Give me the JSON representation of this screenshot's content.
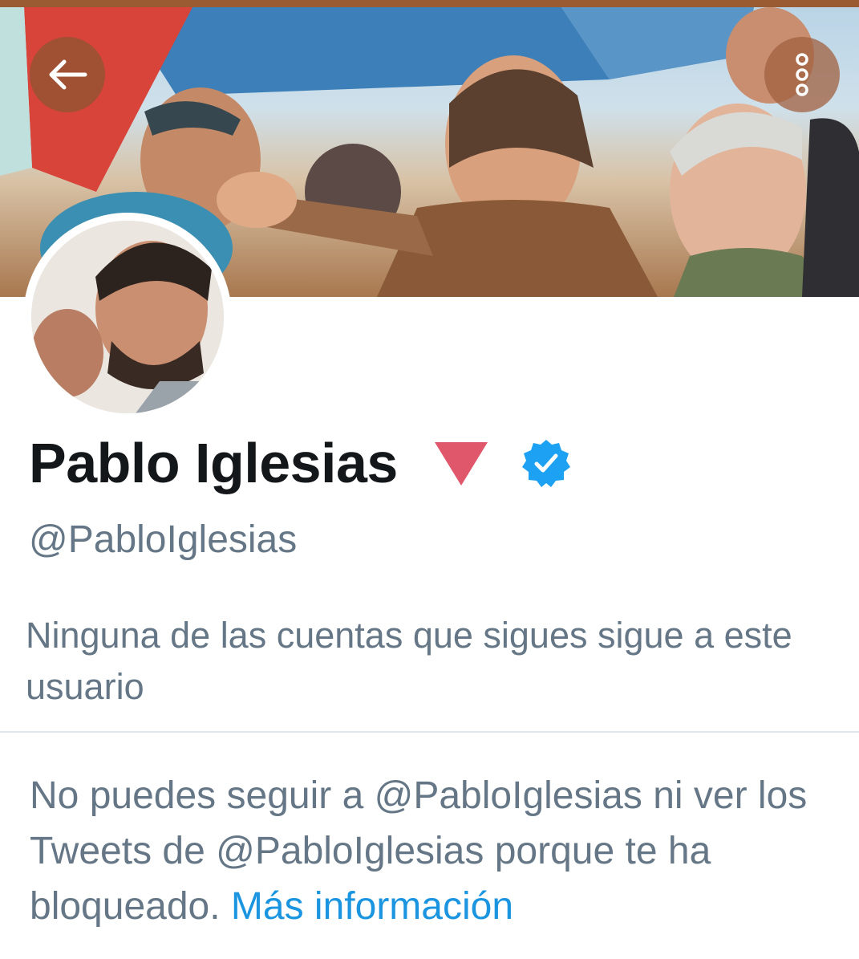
{
  "header": {
    "back_icon": "arrow-left-icon",
    "more_icon": "more-vertical-icon"
  },
  "profile": {
    "name": "Pablo Iglesias",
    "party_emoji": "rose-triangle-icon",
    "verified_icon": "verified-badge-icon",
    "handle": "@PabloIglesias",
    "followers_note": "Ninguna de las cuentas que sigues sigue a este usuario"
  },
  "blocked_notice": {
    "text": "No puedes seguir a @PabloIglesias ni ver los Tweets de @PabloIglesias porque te ha bloqueado. ",
    "link_label": "Más información"
  },
  "colors": {
    "name": "#14171a",
    "secondary_text": "#657786",
    "link": "#1b95e0",
    "verified": "#1da1f2",
    "rose": "#e0566b",
    "divider": "#e1e8ed"
  }
}
